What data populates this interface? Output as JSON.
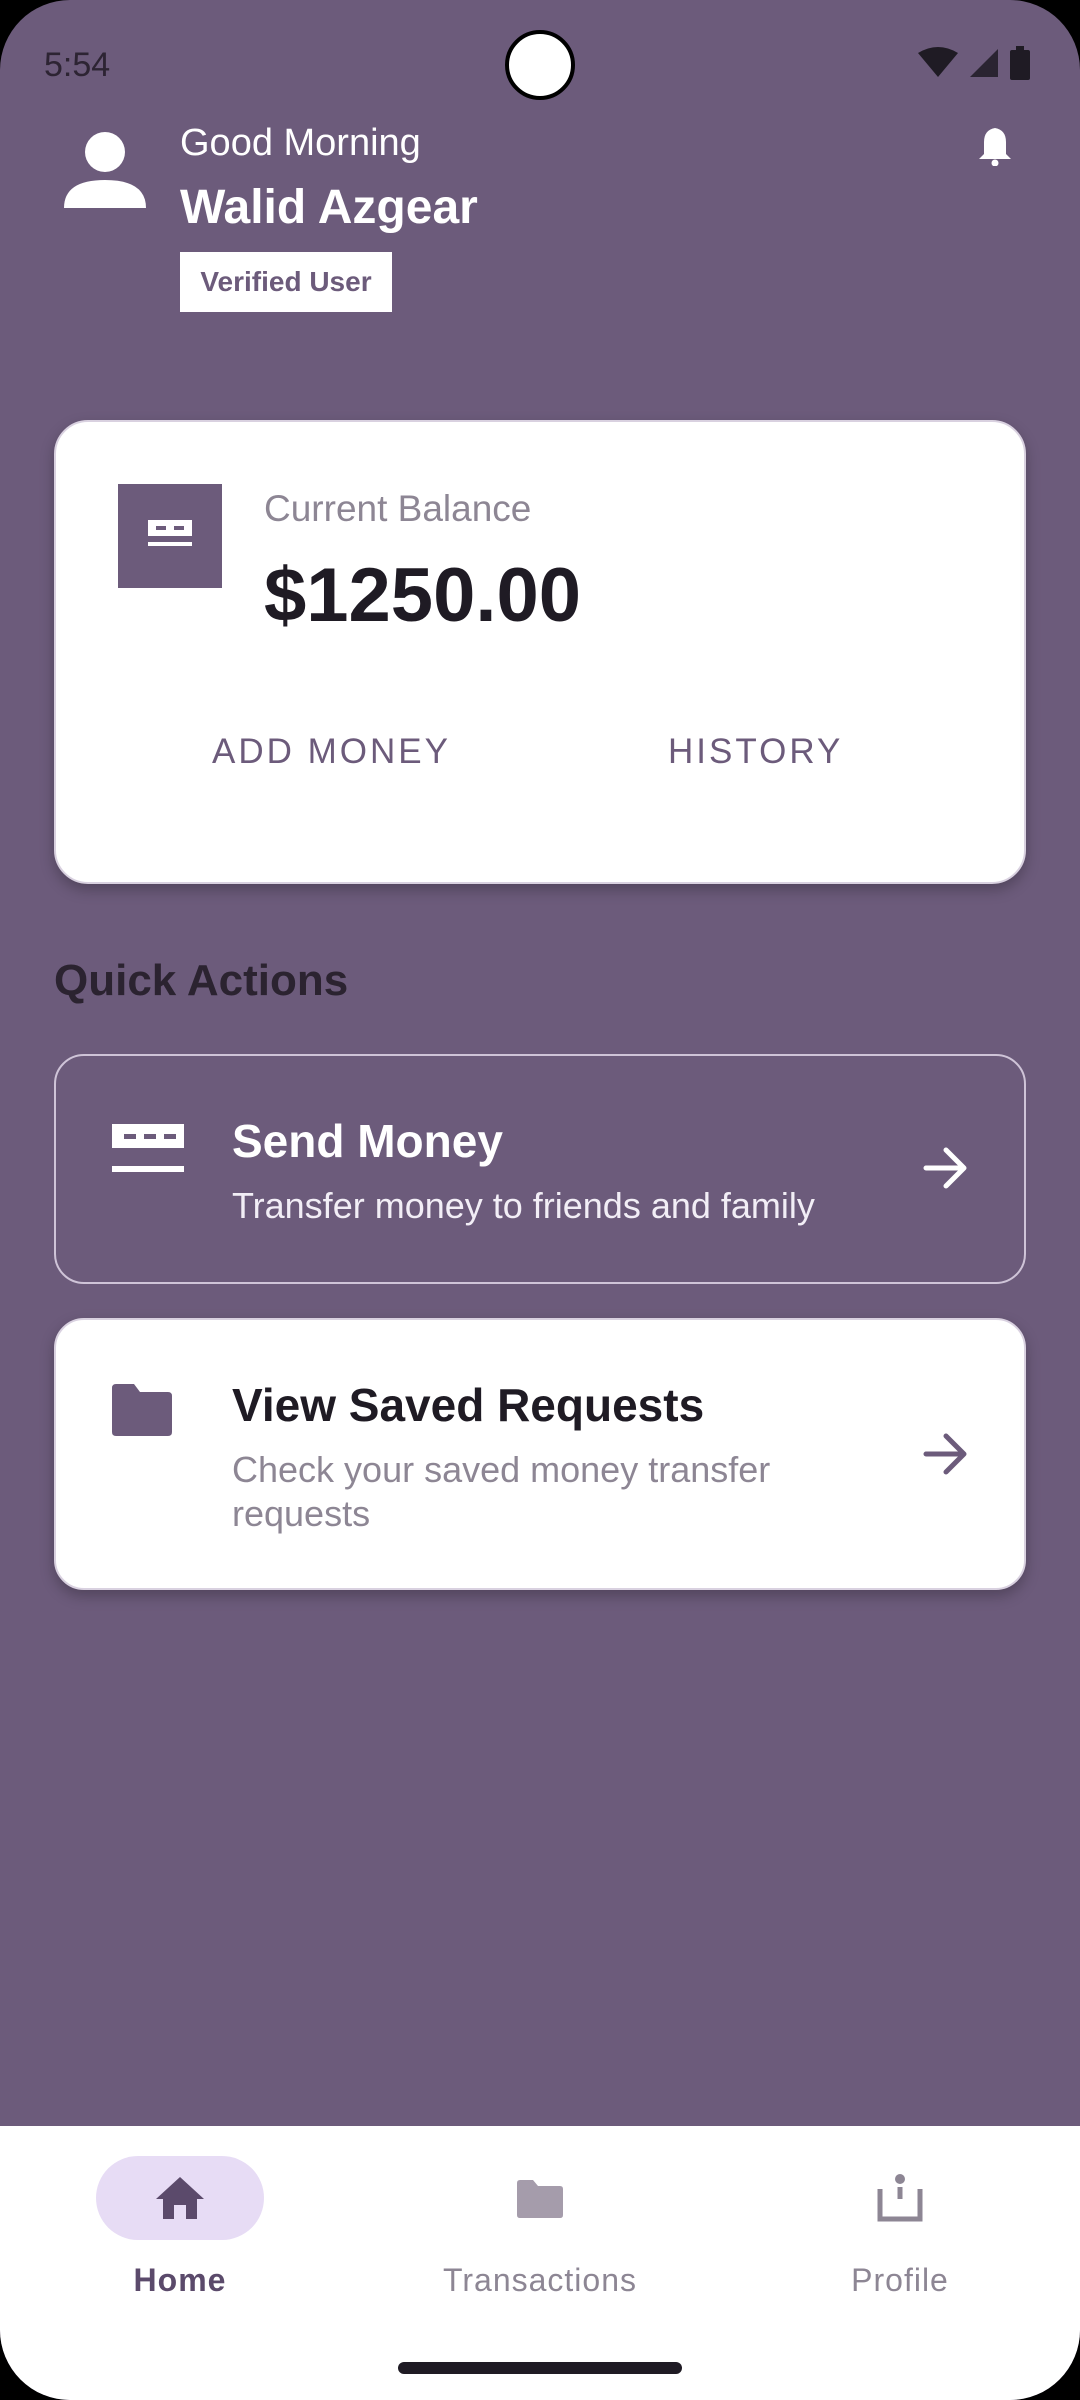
{
  "status_bar": {
    "time": "5:54",
    "icons": [
      "wifi-icon",
      "signal-icon",
      "battery-icon"
    ]
  },
  "header": {
    "greeting": "Good Morning",
    "user_name": "Walid Azgear",
    "badge": "Verified User",
    "icons": [
      "person-icon",
      "bell-icon"
    ]
  },
  "balance_card": {
    "label": "Current Balance",
    "amount": "$1250.00",
    "add_money_label": "ADD MONEY",
    "history_label": "HISTORY",
    "icon": "wallet-icon"
  },
  "quick_actions": {
    "title": "Quick Actions",
    "items": [
      {
        "title": "Send Money",
        "subtitle": "Transfer money to friends and family",
        "icon": "money-icon"
      },
      {
        "title": "View Saved Requests",
        "subtitle": "Check your saved money transfer requests",
        "icon": "folder-icon"
      }
    ]
  },
  "bottom_nav": {
    "items": [
      {
        "label": "Home",
        "icon": "home-icon",
        "active": true
      },
      {
        "label": "Transactions",
        "icon": "folder-icon",
        "active": false
      },
      {
        "label": "Profile",
        "icon": "profile-icon",
        "active": false
      }
    ]
  },
  "colors": {
    "primary": "#6c5b7b",
    "surface": "#ffffff",
    "nav_active_pill": "#e7dcf5",
    "text_dark": "#1f1b24",
    "text_muted": "#8d8694"
  }
}
